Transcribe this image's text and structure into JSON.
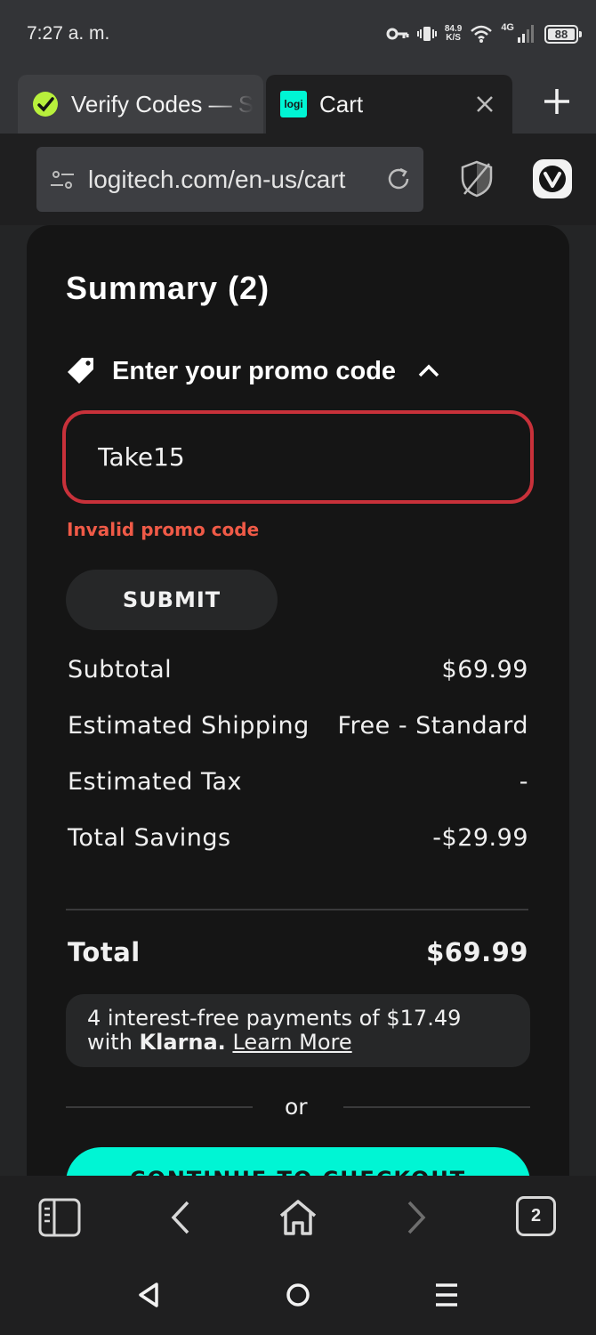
{
  "status_bar": {
    "time": "7:27 a. m.",
    "speed_value": "84.9",
    "speed_unit": "K/S",
    "network": "4G",
    "battery": "88"
  },
  "tabs": [
    {
      "title": "Verify Codes — S",
      "active": false
    },
    {
      "title": "Cart",
      "favicon_text": "logi",
      "active": true
    }
  ],
  "address_bar": {
    "url": "logitech.com/en-us/cart"
  },
  "summary": {
    "title": "Summary (2)",
    "promo_toggle_label": "Enter your promo code",
    "promo_value": "Take15",
    "promo_error": "Invalid promo code",
    "submit_label": "SUBMIT",
    "rows": [
      {
        "label": "Subtotal",
        "value": "$69.99"
      },
      {
        "label": "Estimated Shipping",
        "value": "Free - Standard"
      },
      {
        "label": "Estimated Tax",
        "value": "-"
      },
      {
        "label": "Total Savings",
        "value": "-$29.99"
      }
    ],
    "total_label": "Total",
    "total_value": "$69.99",
    "klarna": {
      "line1": "4 interest-free payments of $17.49",
      "with": "with ",
      "brand": "Klarna.",
      "learn_more": "Learn More"
    },
    "or_text": "or",
    "checkout_label": "CONTINUE TO CHECKOUT"
  },
  "toolbar": {
    "tab_count": "2"
  },
  "colors": {
    "accent": "#00f5d4",
    "error": "#ef5a47",
    "error_border": "#c8313a"
  }
}
